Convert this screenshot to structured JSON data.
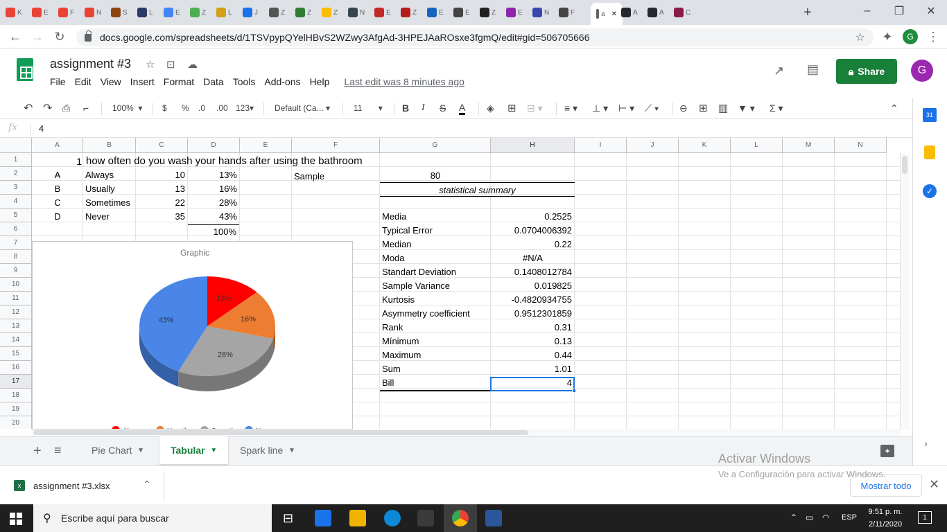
{
  "browser": {
    "tabs": [
      {
        "label": "K",
        "color": "#ea4335"
      },
      {
        "label": "E",
        "color": "#ea4335"
      },
      {
        "label": "F",
        "color": "#ea4335"
      },
      {
        "label": "N",
        "color": "#ea4335"
      },
      {
        "label": "S",
        "color": "#8b4513"
      },
      {
        "label": "L",
        "color": "#2b3a67"
      },
      {
        "label": "E",
        "color": "#4285f4"
      },
      {
        "label": "Z",
        "color": "#4caf50"
      },
      {
        "label": "L",
        "color": "#d4a017"
      },
      {
        "label": "J",
        "color": "#1a73e8"
      },
      {
        "label": "Z",
        "color": "#555555"
      },
      {
        "label": "Z",
        "color": "#2e7d32"
      },
      {
        "label": "Z",
        "color": "#fbbc04"
      },
      {
        "label": "N",
        "color": "#37474f"
      },
      {
        "label": "E",
        "color": "#c62828"
      },
      {
        "label": "Z",
        "color": "#b71c1c"
      },
      {
        "label": "E",
        "color": "#1565c0"
      },
      {
        "label": "E",
        "color": "#444444"
      },
      {
        "label": "Z",
        "color": "#212121"
      },
      {
        "label": "E",
        "color": "#8e24aa"
      },
      {
        "label": "N",
        "color": "#3949ab"
      },
      {
        "label": "F",
        "color": "#444444"
      },
      {
        "label": "a",
        "color": "#5f6368"
      },
      {
        "label": "A",
        "color": "#24292e"
      },
      {
        "label": "A",
        "color": "#24292e"
      },
      {
        "label": "C",
        "color": "#8b1a4a"
      }
    ],
    "new_tab": "+",
    "url": "docs.google.com/spreadsheets/d/1TSVpypQYelHBvS2WZwy3AfgAd-3HPEJAaROsxe3fgmQ/edit#gid=506705666",
    "window_controls": [
      "–",
      "❐",
      "✕"
    ],
    "profile_initial": "G"
  },
  "docs": {
    "title": "assignment #3",
    "menus": [
      "File",
      "Edit",
      "View",
      "Insert",
      "Format",
      "Data",
      "Tools",
      "Add-ons",
      "Help"
    ],
    "last_edit": "Last edit was 8 minutes ago",
    "share": "Share",
    "avatar": "G"
  },
  "toolbar": {
    "zoom": "100%",
    "currency": "$",
    "percent": "%",
    "dec_less": ".0",
    "dec_more": ".00",
    "format_123": "123",
    "font": "Default (Ca...",
    "font_size": "11",
    "bold": "B",
    "italic": "I",
    "strike": "S",
    "text_color": "A",
    "sum": "Σ"
  },
  "formula_bar": {
    "fx": "fx",
    "value": "4"
  },
  "columns": [
    "A",
    "B",
    "C",
    "D",
    "E",
    "F",
    "G",
    "H",
    "I",
    "J",
    "K",
    "L",
    "M",
    "N"
  ],
  "rows": [
    "1",
    "2",
    "3",
    "4",
    "5",
    "6",
    "7",
    "8",
    "9",
    "10",
    "11",
    "12",
    "13",
    "14",
    "15",
    "16",
    "17",
    "18",
    "19",
    "20"
  ],
  "cells": {
    "r1_a": "1",
    "r1_title": "how often do you wash your hands after using the bathroom",
    "options": [
      {
        "letter": "A",
        "label": "Always",
        "count": "10",
        "pct": "13%"
      },
      {
        "letter": "B",
        "label": "Usually",
        "count": "13",
        "pct": "16%"
      },
      {
        "letter": "C",
        "label": "Sometimes",
        "count": "22",
        "pct": "28%"
      },
      {
        "letter": "D",
        "label": "Never",
        "count": "35",
        "pct": "43%"
      }
    ],
    "total_pct": "100%",
    "sample_label": "Sample",
    "sample_value": "80",
    "summary_title": "statistical summary",
    "stats": [
      {
        "label": "Media",
        "value": "0.2525"
      },
      {
        "label": "Typical Error",
        "value": "0.0704006392"
      },
      {
        "label": "Median",
        "value": "0.22"
      },
      {
        "label": "Moda",
        "value": "#N/A"
      },
      {
        "label": "Standart Deviation",
        "value": "0.1408012784"
      },
      {
        "label": "Sample Variance",
        "value": "0.019825"
      },
      {
        "label": "Kurtosis",
        "value": "-0.4820934755"
      },
      {
        "label": "Asymmetry coefficient",
        "value": "0.9512301859"
      },
      {
        "label": "Rank",
        "value": "0.31"
      },
      {
        "label": "Mínimum",
        "value": "0.13"
      },
      {
        "label": "Maximum",
        "value": "0.44"
      },
      {
        "label": "Sum",
        "value": "1.01"
      },
      {
        "label": "Bill",
        "value": "4"
      }
    ]
  },
  "chart_data": {
    "type": "pie",
    "title": "Graphic",
    "categories": [
      "Always",
      "Usually",
      "Sometimes",
      "Never"
    ],
    "values": [
      13,
      16,
      28,
      43
    ],
    "labels": [
      "13%",
      "16%",
      "28%",
      "43%"
    ],
    "colors": [
      "#ff0000",
      "#ed7d31",
      "#a5a5a5",
      "#4a86e8"
    ],
    "legend_position": "bottom"
  },
  "sheet_tabs": [
    {
      "label": "Pie Chart",
      "active": false
    },
    {
      "label": "Tabular",
      "active": true
    },
    {
      "label": "Spark line",
      "active": false
    }
  ],
  "watermark": {
    "line1": "Activar Windows",
    "line2": "Ve a Configuración para activar Windows."
  },
  "download": {
    "file": "assignment #3.xlsx",
    "show_all": "Mostrar todo"
  },
  "taskbar": {
    "search_placeholder": "Escribe aquí para buscar",
    "lang": "ESP",
    "time": "9:51 p. m.",
    "date": "2/11/2020",
    "notif_count": "1"
  }
}
